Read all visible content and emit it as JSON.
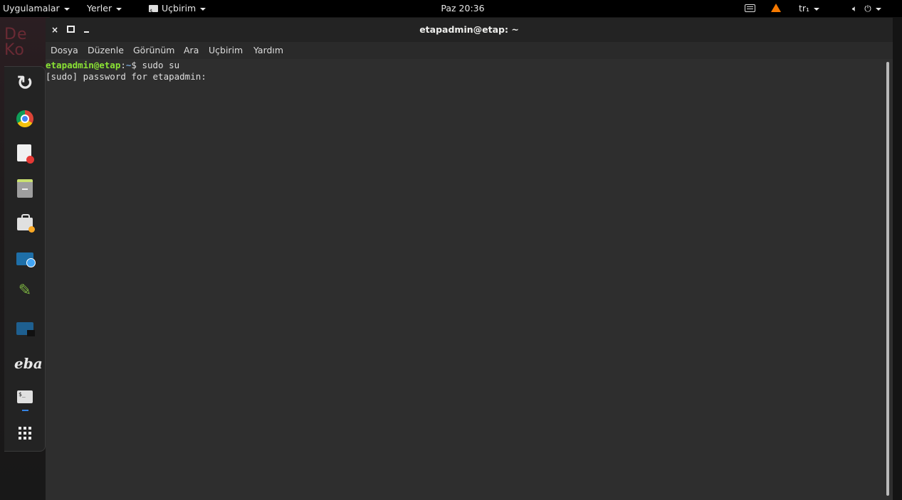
{
  "top_panel": {
    "applications_label": "Uygulamalar",
    "places_label": "Yerler",
    "app_menu_label": "Uçbirim",
    "clock": "Paz 20:36",
    "keyboard_layout": "tr₁"
  },
  "wallpaper_text": "De Ko",
  "window": {
    "title": "etapadmin@etap: ~",
    "close_symbol": "×"
  },
  "menubar": {
    "items": [
      "Dosya",
      "Düzenle",
      "Görünüm",
      "Ara",
      "Uçbirim",
      "Yardım"
    ]
  },
  "terminal": {
    "prompt_user": "etapadmin@etap",
    "prompt_sep": ":",
    "prompt_path": "~",
    "prompt_suffix": "$ ",
    "command": "sudo su",
    "output_line": "[sudo] password for etapadmin:"
  },
  "dock": {
    "items": [
      {
        "icon": "refresh-icon"
      },
      {
        "icon": "chrome-icon"
      },
      {
        "icon": "document-viewer-icon"
      },
      {
        "icon": "file-manager-icon"
      },
      {
        "icon": "software-center-icon"
      },
      {
        "icon": "screenshot-icon"
      },
      {
        "icon": "pencil-icon"
      },
      {
        "icon": "screen-record-icon"
      },
      {
        "icon": "eba-icon",
        "label": "eba"
      },
      {
        "icon": "terminal-icon"
      },
      {
        "icon": "app-grid-icon"
      }
    ]
  },
  "colors": {
    "prompt_user": "#8ae234",
    "prompt_path": "#729fcf",
    "terminal_bg": "#2e2e2e",
    "panel_bg": "#000000",
    "warning": "#f57900"
  }
}
